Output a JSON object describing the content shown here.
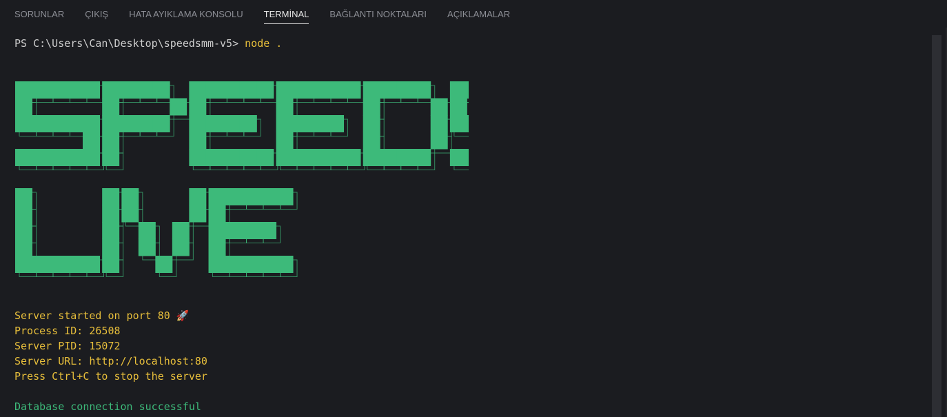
{
  "tabs": [
    {
      "label": "SORUNLAR"
    },
    {
      "label": "ÇIKIŞ"
    },
    {
      "label": "HATA AYIKLAMA KONSOLU"
    },
    {
      "label": "TERMİNAL"
    },
    {
      "label": "BAĞLANTI NOKTALARI"
    },
    {
      "label": "AÇIKLAMALAR"
    }
  ],
  "terminal": {
    "prompt": "PS C:\\Users\\Can\\Desktop\\speedsmm-v5> ",
    "command": "node .",
    "banner_lines": [
      "SPEEDSMM",
      "LIVE"
    ],
    "output": [
      "Server started on port 80 🚀",
      "Process ID: 26508",
      "Server PID: 15072",
      "Server URL: http://localhost:80",
      "Press Ctrl+C to stop the server",
      "",
      "Database connection successful"
    ]
  },
  "colors": {
    "background": "#1b1c20",
    "banner_green": "#3dba7a",
    "output_yellow": "#e8bf3b",
    "success_green": "#3dba7a"
  }
}
